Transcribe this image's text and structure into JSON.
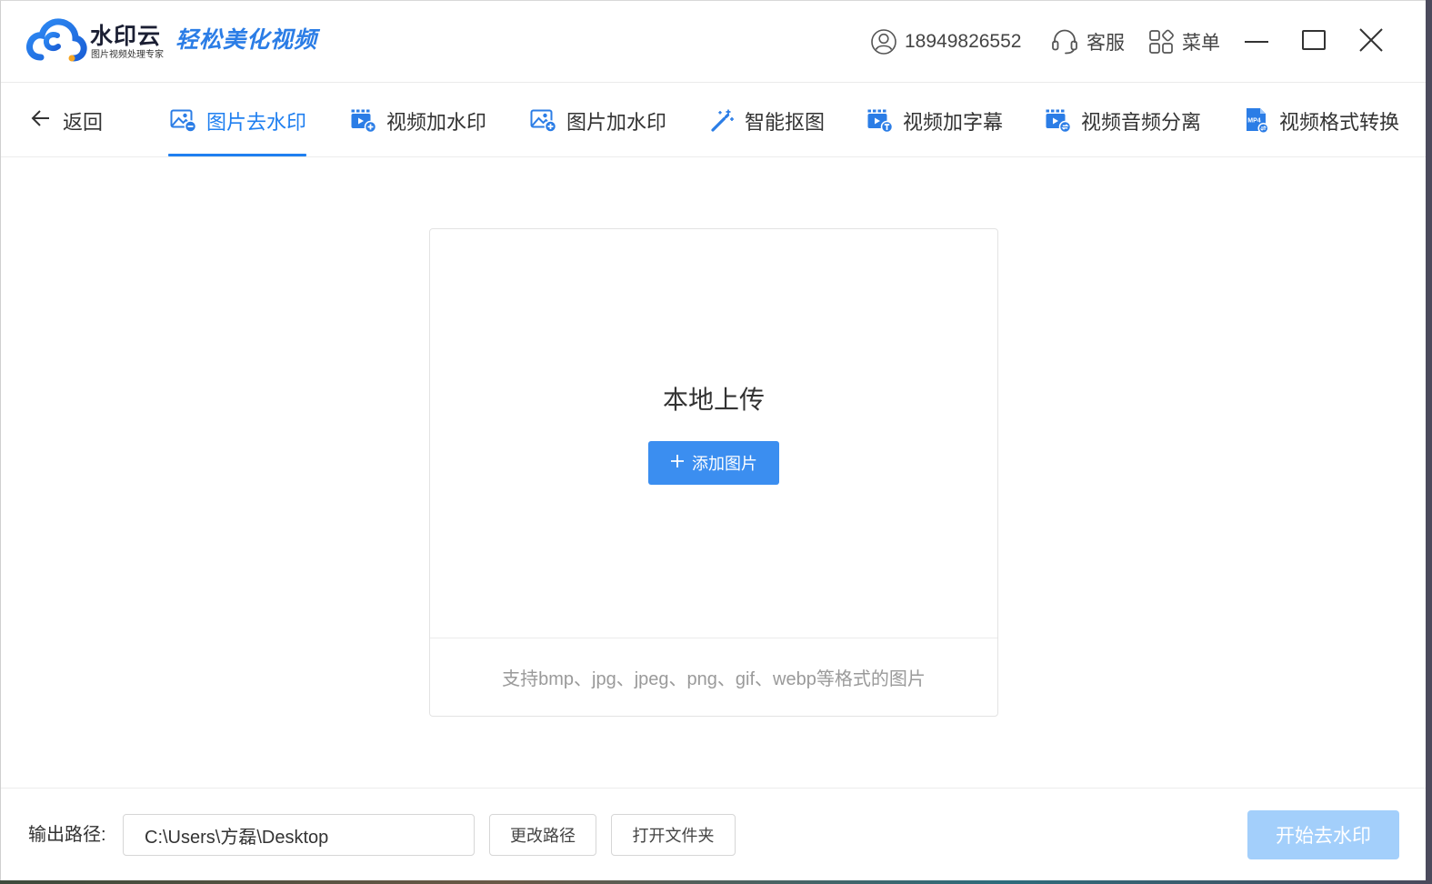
{
  "header": {
    "brand_name": "水印云",
    "brand_tagline": "图片视频处理专家",
    "slogan": "轻松美化视频",
    "phone": "18949826552",
    "support_label": "客服",
    "menu_label": "菜单"
  },
  "nav": {
    "back_label": "返回",
    "tabs": [
      {
        "label": "图片去水印",
        "icon": "image-remove-icon",
        "active": true
      },
      {
        "label": "视频加水印",
        "icon": "video-add-icon",
        "active": false
      },
      {
        "label": "图片加水印",
        "icon": "image-add-icon",
        "active": false
      },
      {
        "label": "智能抠图",
        "icon": "magic-wand-icon",
        "active": false
      },
      {
        "label": "视频加字幕",
        "icon": "video-subtitle-icon",
        "active": false
      },
      {
        "label": "视频音频分离",
        "icon": "video-audio-split-icon",
        "active": false
      },
      {
        "label": "视频格式转换",
        "icon": "mp4-file-icon",
        "active": false,
        "badge": "MP4"
      }
    ]
  },
  "upload": {
    "title": "本地上传",
    "button_label": "添加图片",
    "button_icon": "plus-icon",
    "hint": "支持bmp、jpg、jpeg、png、gif、webp等格式的图片"
  },
  "footer": {
    "output_label": "输出路径:",
    "output_path": "C:\\Users\\方磊\\Desktop",
    "change_path_label": "更改路径",
    "open_folder_label": "打开文件夹",
    "start_label": "开始去水印"
  },
  "icons": {
    "logo": "cloud-logo-icon",
    "user": "user-icon",
    "support": "headset-icon",
    "menu": "grid-menu-icon",
    "minimize": "minimize-icon",
    "maximize": "maximize-icon",
    "close": "close-icon",
    "back": "arrow-left-icon"
  },
  "colors": {
    "accent": "#1f7ff0",
    "icon": "#2b7de6",
    "button": "#3b8ef0",
    "start_button": "#a3cffb"
  }
}
